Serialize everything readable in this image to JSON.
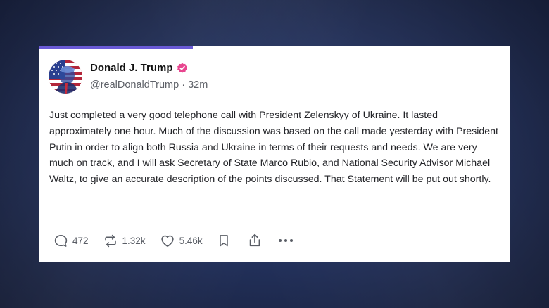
{
  "post": {
    "author": {
      "display_name": "Donald J. Trump",
      "handle": "@realDonaldTrump",
      "separator": "·",
      "time_ago": "32m",
      "verified_color": "#e8468f"
    },
    "text": "Just completed a very good telephone call with President Zelenskyy of Ukraine. It lasted approximately one hour. Much of the discussion was based on the call made yesterday with President Putin in order to align both Russia and Ukraine in terms of their requests and needs. We are very much on track, and I will ask Secretary of State Marco Rubio, and National Security Advisor Michael Waltz, to give an accurate description of the points discussed. That Statement will be put out shortly.",
    "actions": {
      "replies": "472",
      "reposts": "1.32k",
      "likes": "5.46k"
    }
  },
  "icons": [
    "verified-badge-icon",
    "reply-icon",
    "repost-icon",
    "like-icon",
    "bookmark-icon",
    "share-icon",
    "more-icon"
  ],
  "colors": {
    "background": "#1d2846",
    "card": "#ffffff",
    "accent_line": "#6a5ad6",
    "text_primary": "#111111",
    "text_secondary": "#5e6168"
  }
}
